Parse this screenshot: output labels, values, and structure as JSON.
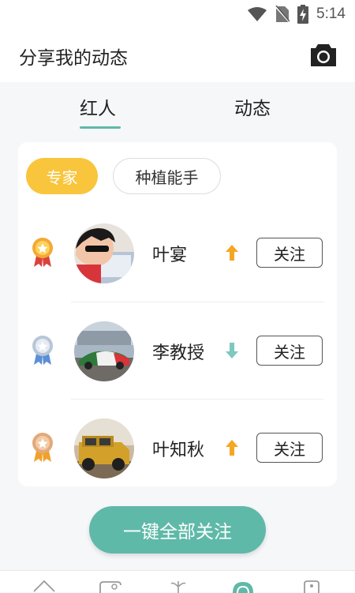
{
  "status_bar": {
    "time": "5:14",
    "icons": [
      "wifi-icon",
      "no-sim-icon",
      "battery-charging-icon"
    ]
  },
  "header": {
    "title": "分享我的动态",
    "camera_icon": "camera-icon"
  },
  "tabs": [
    {
      "label": "红人",
      "active": true
    },
    {
      "label": "动态",
      "active": false
    }
  ],
  "colors": {
    "accent": "#5fb9a8",
    "chip_active": "#f9c53c",
    "arrow_up": "#f5a623",
    "arrow_down": "#7ec8bd"
  },
  "filters": [
    {
      "label": "专家",
      "active": true
    },
    {
      "label": "种植能手",
      "active": false
    }
  ],
  "ranking": [
    {
      "rank": 1,
      "medal": "gold-medal-icon",
      "name": "叶宴",
      "trend": "up",
      "follow_label": "关注"
    },
    {
      "rank": 2,
      "medal": "silver-medal-icon",
      "name": "李教授",
      "trend": "down",
      "follow_label": "关注"
    },
    {
      "rank": 3,
      "medal": "bronze-medal-icon",
      "name": "叶知秋",
      "trend": "up",
      "follow_label": "关注"
    }
  ],
  "follow_all_label": "一键全部关注",
  "bottom_nav": [
    "home-icon",
    "leaf-card-icon",
    "plant-icon",
    "share-circle-icon",
    "profile-icon"
  ]
}
